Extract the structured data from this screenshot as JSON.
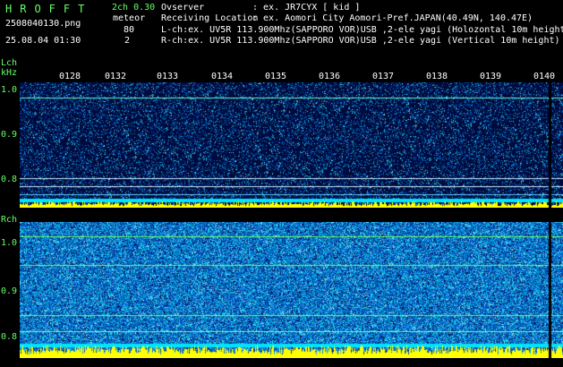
{
  "header": {
    "app_title": "HROFFT",
    "filename": "2508040130.png",
    "datetime": "25.08.04 01:30",
    "mode": "2ch 0.30",
    "meteor_label": "meteor",
    "meteor_count_l": "80",
    "meteor_count_r": "2",
    "observer_label": "Ovserver",
    "observer_value": ": ex. JR7CYX [ kid ]",
    "location_label": "Receiving Location",
    "location_value": ": ex. Aomori City Aomori-Pref.JAPAN(40.49N, 140.47E)",
    "lch_info": "L-ch:ex. UV5R 113.900Mhz(SAPPORO VOR)USB ,2-ele yagi (Holozontal 10m height)",
    "rch_info": "R-ch:ex. UV5R 113.900Mhz(SAPPORO VOR)USB ,2-ele yagi (Vertical 10m height)"
  },
  "lch": {
    "label": "Lch",
    "unit": "kHz",
    "y_ticks": [
      "1.0",
      "0.9",
      "0.8"
    ],
    "time_ticks": [
      "0128",
      "0132",
      "0133",
      "0134",
      "0135",
      "0136",
      "0137",
      "0138",
      "0139",
      "0140"
    ]
  },
  "rch": {
    "label": "Rch",
    "y_ticks": [
      "1.0",
      "0.9",
      "0.8"
    ]
  },
  "colors": {
    "background": "#000000",
    "text_green": "#66ff66",
    "text_white": "#ffffff",
    "spectrogram_low": "#1a2a80",
    "spectrogram_high": "#ffff00",
    "trace_cyan": "#00ffff"
  }
}
